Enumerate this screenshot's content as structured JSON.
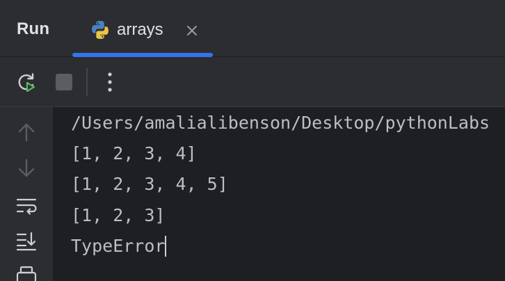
{
  "header": {
    "title": "Run",
    "tab": {
      "label": "arrays",
      "icon": "python-icon",
      "active_color": "#3574f0"
    }
  },
  "toolbar": {
    "buttons": [
      {
        "name": "rerun-icon"
      },
      {
        "name": "stop-icon"
      },
      {
        "name": "more-options-icon"
      }
    ]
  },
  "gutter": {
    "buttons": [
      {
        "name": "scroll-up-icon"
      },
      {
        "name": "scroll-down-icon"
      },
      {
        "name": "soft-wrap-icon"
      },
      {
        "name": "scroll-to-end-icon"
      },
      {
        "name": "print-icon"
      }
    ]
  },
  "console": {
    "lines": [
      "/Users/amalialibenson/Desktop/pythonLabs",
      "[1, 2, 3, 4]",
      "[1, 2, 3, 4, 5]",
      "[1, 2, 3]",
      "TypeError"
    ]
  }
}
